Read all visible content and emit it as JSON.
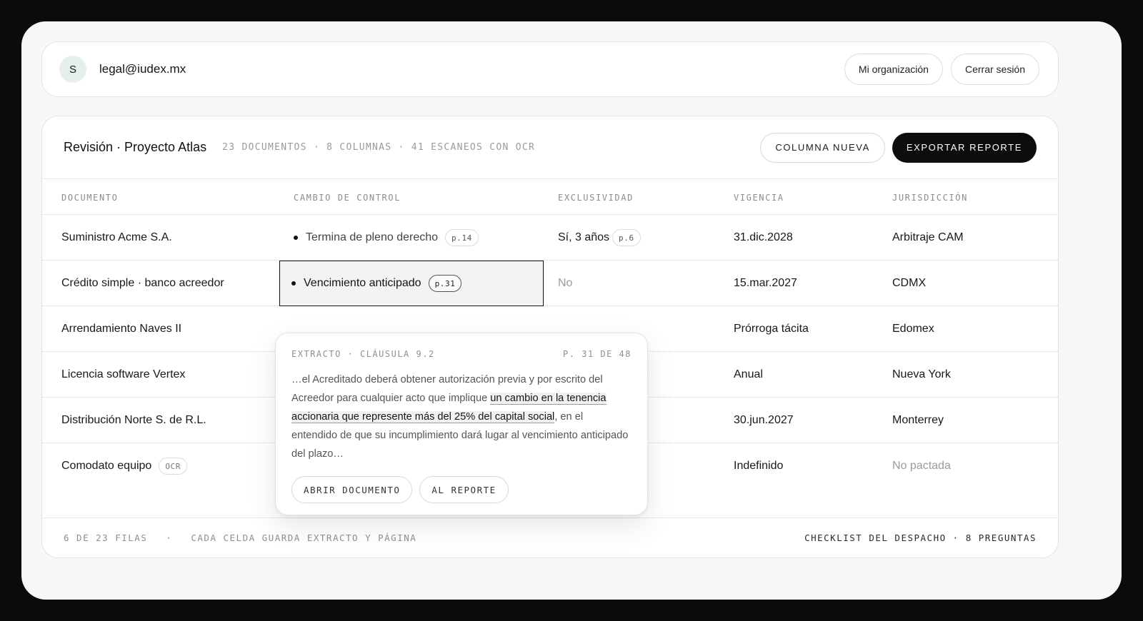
{
  "user": {
    "initial": "S",
    "email": "legal@iudex.mx"
  },
  "top_actions": {
    "org": "Mi organización",
    "logout": "Cerrar sesión"
  },
  "review": {
    "title": "Revisión · Proyecto Atlas",
    "meta": "23 documentos · 8 columnas · 41 escaneos con OCR",
    "new_column": "COLUMNA NUEVA",
    "export": "EXPORTAR REPORTE"
  },
  "columns": [
    "DOCUMENTO",
    "CAMBIO DE CONTROL",
    "EXCLUSIVIDAD",
    "VIGENCIA",
    "JURISDICCIÓN"
  ],
  "rows": [
    {
      "doc": "Suministro Acme S.A.",
      "cc": "Termina de pleno derecho",
      "cc_page": "p.14",
      "excl": "Sí, 3 años",
      "excl_page": "p.6",
      "vig": "31.dic.2028",
      "jur": "Arbitraje CAM"
    },
    {
      "doc": "Crédito simple · banco acreedor",
      "cc": "Vencimiento anticipado",
      "cc_page": "p.31",
      "excl": "No",
      "vig": "15.mar.2027",
      "jur": "CDMX"
    },
    {
      "doc": "Arrendamiento Naves II",
      "vig": "Prórroga tácita",
      "jur": "Edomex"
    },
    {
      "doc": "Licencia software Vertex",
      "vig": "Anual",
      "jur": "Nueva York"
    },
    {
      "doc": "Distribución Norte S. de R.L.",
      "vig": "30.jun.2027",
      "jur": "Monterrey"
    },
    {
      "doc": "Comodato equipo",
      "doc_tag": "OCR",
      "vig": "Indefinido",
      "jur": "No pactada"
    }
  ],
  "popover": {
    "label": "EXTRACTO · CLÁUSULA 9.2",
    "page": "P. 31 DE 48",
    "text_before": "…el Acreditado deberá obtener autorización previa y por escrito del Acreedor para cualquier acto que implique ",
    "text_highlight": "un cambio en la tenencia accionaria que represente más del 25% del capital social",
    "text_after": ", en el entendido de que su incumplimiento dará lugar al vencimiento anticipado del plazo…",
    "open_doc": "ABRIR DOCUMENTO",
    "to_report": "AL REPORTE"
  },
  "footer": {
    "rows": "6 DE 23 FILAS",
    "dot": "·",
    "note": "CADA CELDA GUARDA EXTRACTO Y PÁGINA",
    "checklist": "CHECKLIST DEL DESPACHO · 8 PREGUNTAS"
  }
}
